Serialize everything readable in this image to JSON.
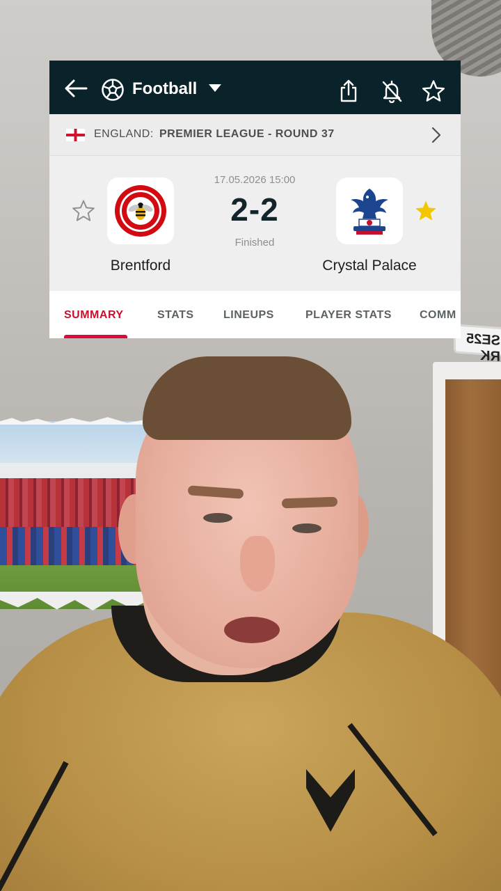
{
  "header": {
    "sport": "Football",
    "icons": [
      "back-arrow-icon",
      "football-icon",
      "dropdown-caret-icon",
      "share-icon",
      "bell-off-icon",
      "star-outline-icon"
    ]
  },
  "league": {
    "country": "ENGLAND:",
    "competition": "PREMIER LEAGUE - ROUND 37"
  },
  "match": {
    "datetime": "17.05.2026 15:00",
    "score": "2-2",
    "status": "Finished",
    "home": {
      "name": "Brentford",
      "favorite": false
    },
    "away": {
      "name": "Crystal Palace",
      "favorite": true
    }
  },
  "tabs": [
    {
      "label": "SUMMARY",
      "active": true
    },
    {
      "label": "STATS",
      "active": false
    },
    {
      "label": "LINEUPS",
      "active": false
    },
    {
      "label": "PLAYER STATS",
      "active": false
    },
    {
      "label": "COMM",
      "active": false
    }
  ],
  "background": {
    "sign_text": "SE25 RK"
  },
  "colors": {
    "header_bg": "#0a2229",
    "accent": "#dc0a3c",
    "favorite_star": "#f2c700"
  }
}
